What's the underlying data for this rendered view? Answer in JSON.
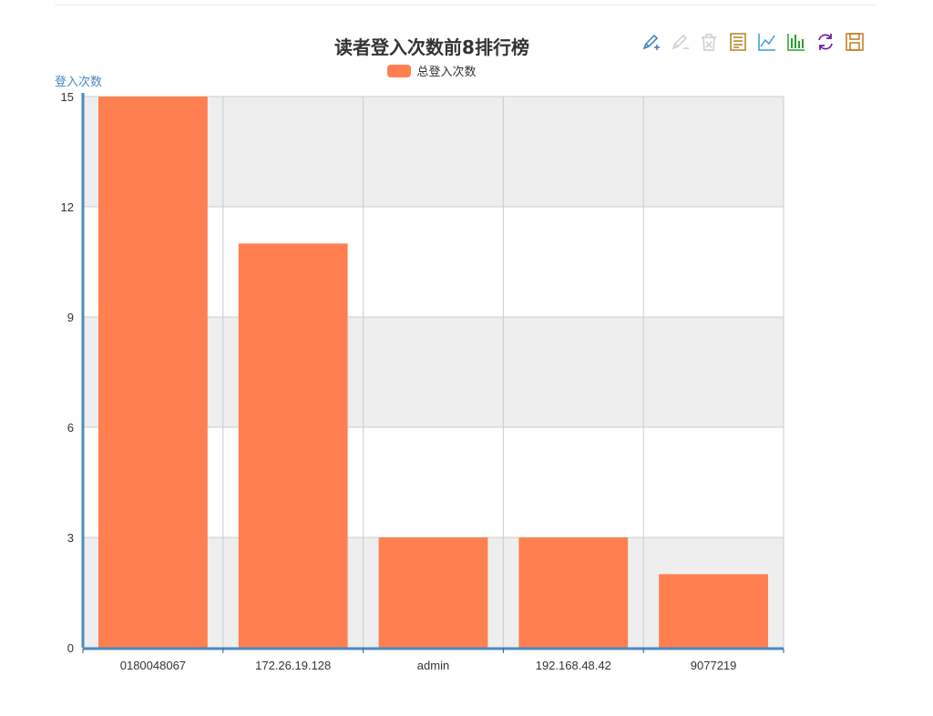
{
  "chart_data": {
    "type": "bar",
    "title": "读者登入次数前8排行榜",
    "ylabel": "登入次数",
    "xlabel": "",
    "legend": [
      "总登入次数"
    ],
    "legend_position": "top-center",
    "categories": [
      "0180048067",
      "172.26.19.128",
      "admin",
      "192.168.48.42",
      "9077219"
    ],
    "series": [
      {
        "name": "总登入次数",
        "values": [
          15,
          11,
          3,
          3,
          2
        ]
      }
    ],
    "ylim": [
      0,
      15
    ],
    "yticks": [
      "0",
      "3",
      "6",
      "9",
      "12",
      "15"
    ],
    "grid": true,
    "bar_color": "#ff7f50",
    "axis_color": "#4a8ac0",
    "split_area_colors": [
      "#eeeeee",
      "#ffffff"
    ]
  },
  "toolbox": {
    "icons": [
      {
        "name": "data-zoom-icon",
        "color": "#3a7bbf"
      },
      {
        "name": "data-zoom-reset-icon",
        "color": "#cccccc"
      },
      {
        "name": "clear-icon",
        "color": "#cccccc"
      },
      {
        "name": "data-view-icon",
        "color": "#b08020"
      },
      {
        "name": "line-chart-icon",
        "color": "#3a9bd0"
      },
      {
        "name": "bar-chart-icon",
        "color": "#2e9e2e"
      },
      {
        "name": "restore-icon",
        "color": "#6a1a9a"
      },
      {
        "name": "save-image-icon",
        "color": "#c07a1a"
      }
    ]
  }
}
